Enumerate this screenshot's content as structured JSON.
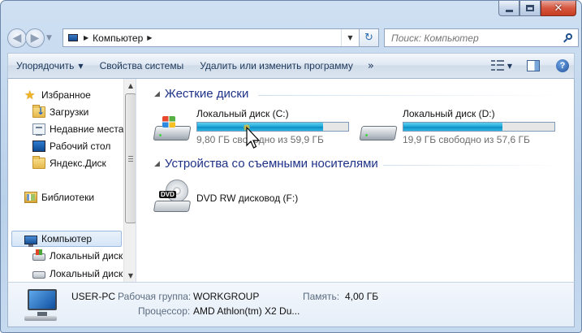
{
  "window": {
    "caption_buttons": {
      "minimize": "minimize-icon",
      "maximize": "maximize-icon",
      "close": "✕"
    }
  },
  "address_bar": {
    "path": "Компьютер",
    "search_placeholder": "Поиск: Компьютер"
  },
  "toolbar": {
    "organize": "Упорядочить",
    "system_properties": "Свойства системы",
    "uninstall": "Удалить или изменить программу",
    "more": "»"
  },
  "nav_pane": {
    "favorites": "Избранное",
    "downloads": "Загрузки",
    "recent": "Недавние места",
    "desktop": "Рабочий стол",
    "yandex_disk": "Яндекс.Диск",
    "libraries": "Библиотеки",
    "computer": "Компьютер",
    "local_disk_1": "Локальный диск",
    "local_disk_2": "Локальный диск"
  },
  "groups": {
    "hard_disks": "Жесткие диски",
    "removable": "Устройства со съемными носителями"
  },
  "drives": [
    {
      "name": "Локальный диск (C:)",
      "free": "9,80 ГБ свободно из 59,9 ГБ",
      "used_fraction": 0.836
    },
    {
      "name": "Локальный диск (D:)",
      "free": "19,9 ГБ свободно из 57,6 ГБ",
      "used_fraction": 0.655
    }
  ],
  "dvd": {
    "name": "DVD RW дисковод (F:)",
    "badge": "DVD"
  },
  "details": {
    "pc_name": "USER-PC",
    "workgroup_label": "Рабочая группа:",
    "workgroup": "WORKGROUP",
    "memory_label": "Память:",
    "memory": "4,00 ГБ",
    "cpu_label": "Процессор:",
    "cpu": "AMD Athlon(tm) X2 Du..."
  },
  "colors": {
    "group_title": "#1e3287",
    "bar_fill": "#1fa7d9",
    "window_frame": "#b9d1ea"
  }
}
